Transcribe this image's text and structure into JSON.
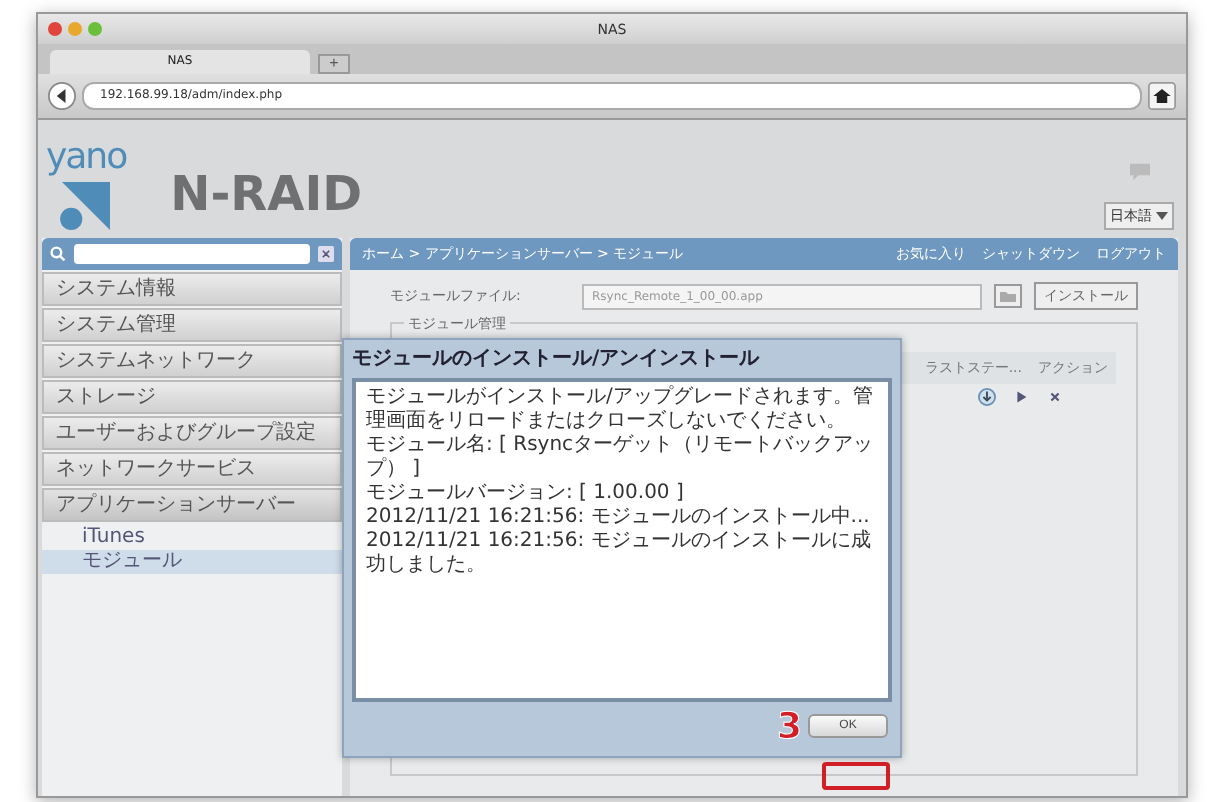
{
  "window": {
    "title": "NAS"
  },
  "tabs": [
    {
      "label": "NAS",
      "selected": true
    }
  ],
  "new_tab": "+",
  "address_bar": {
    "url": "192.168.99.18/adm/index.php"
  },
  "header": {
    "logo_text": "yano",
    "product": "N-RAID",
    "language": "日本語"
  },
  "sidebar": {
    "items": [
      {
        "label": "システム情報",
        "expanded": false
      },
      {
        "label": "システム管理",
        "expanded": false
      },
      {
        "label": "システムネットワーク",
        "expanded": false
      },
      {
        "label": "ストレージ",
        "expanded": false
      },
      {
        "label": "ユーザーおよびグループ設定",
        "expanded": false
      },
      {
        "label": "ネットワークサービス",
        "expanded": false
      },
      {
        "label": "アプリケーションサーバー",
        "expanded": true,
        "children": [
          {
            "label": "iTunes",
            "selected": false
          },
          {
            "label": "モジュール",
            "selected": true
          }
        ]
      }
    ]
  },
  "breadcrumb": "ホーム > アプリケーションサーバー > モジュール",
  "top_links": [
    "お気に入り",
    "シャットダウン",
    "ログアウト"
  ],
  "module_file": {
    "label": "モジュールファイル:",
    "value": "Rsync_Remote_1_00_00.app",
    "button": "インストール"
  },
  "module_management": {
    "legend": "モジュール管理",
    "columns": [
      "ラストステー...",
      "アクション"
    ]
  },
  "dialog": {
    "title": "モジュールのインストール/アンインストール",
    "lines": [
      "モジュールがインストール/アップグレードされます。管理画面をリロードまたはクローズしないでください。",
      "モジュール名: [ Rsyncターゲット（リモートバックアップ） ]",
      "モジュールバージョン: [ 1.00.00 ]",
      "2012/11/21 16:21:56: モジュールのインストール中...",
      "2012/11/21 16:21:56: モジュールのインストールに成功しました。"
    ],
    "button": "OK"
  },
  "annotation": {
    "number": "3"
  }
}
